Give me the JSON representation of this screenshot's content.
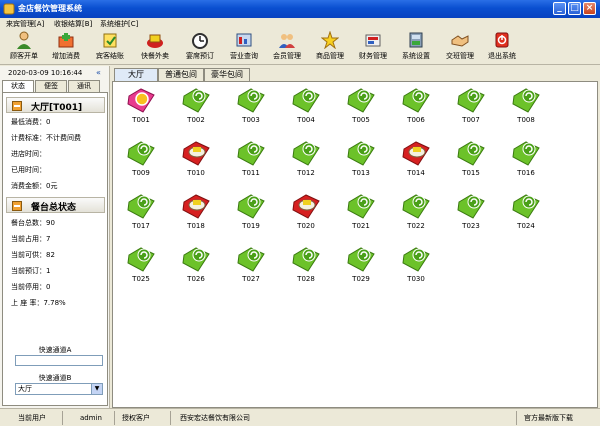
{
  "window": {
    "title": "金店餐饮管理系统"
  },
  "menu": [
    "来宾管理[A]",
    "收银结算[B]",
    "系统维护[C]"
  ],
  "toolbar": [
    {
      "label": "顾客开单",
      "icon": "person-icon"
    },
    {
      "label": "增加消费",
      "icon": "add-cart-icon"
    },
    {
      "label": "宾客结账",
      "icon": "checkout-icon"
    },
    {
      "label": "快餐外卖",
      "icon": "takeout-icon"
    },
    {
      "label": "宴席预订",
      "icon": "clock-icon"
    },
    {
      "label": "营业查询",
      "icon": "query-icon"
    },
    {
      "label": "会员管理",
      "icon": "members-icon"
    },
    {
      "label": "商品管理",
      "icon": "star-icon"
    },
    {
      "label": "财务管理",
      "icon": "finance-icon"
    },
    {
      "label": "系统设置",
      "icon": "settings-icon"
    },
    {
      "label": "交班管理",
      "icon": "handshake-icon"
    },
    {
      "label": "退出系统",
      "icon": "exit-icon"
    }
  ],
  "left": {
    "datetime": "2020-03-09 10:16:44",
    "collapse": "«",
    "tabs": [
      "状态",
      "便签",
      "通讯"
    ],
    "table_header": "大厅[T001]",
    "table_info": [
      "最低消费：0",
      "计费标准：不计费间费",
      "进店时间：",
      "已用时间：",
      "消费金额：0元"
    ],
    "status_header": "餐台总状态",
    "status_info": [
      "餐台总数：90",
      "当前占用：7",
      "当前可供：82",
      "当前预订：1",
      "当前停用：0",
      "上 座 率：7.78%"
    ],
    "quick_a_label": "快速通道A",
    "quick_a_value": "",
    "quick_b_label": "快速通道B",
    "quick_b_value": "大厅",
    "quick_b_arrow": "▼"
  },
  "tabs": [
    "大厅",
    "普通包间",
    "豪华包间"
  ],
  "tables": [
    {
      "name": "T001",
      "state": "selected"
    },
    {
      "name": "T002",
      "state": "free"
    },
    {
      "name": "T003",
      "state": "free"
    },
    {
      "name": "T004",
      "state": "free"
    },
    {
      "name": "T005",
      "state": "free"
    },
    {
      "name": "T006",
      "state": "free"
    },
    {
      "name": "T007",
      "state": "free"
    },
    {
      "name": "T008",
      "state": "free"
    },
    {
      "name": "T009",
      "state": "free"
    },
    {
      "name": "T010",
      "state": "occupied"
    },
    {
      "name": "T011",
      "state": "free"
    },
    {
      "name": "T012",
      "state": "free"
    },
    {
      "name": "T013",
      "state": "free"
    },
    {
      "name": "T014",
      "state": "occupied"
    },
    {
      "name": "T015",
      "state": "free"
    },
    {
      "name": "T016",
      "state": "free"
    },
    {
      "name": "T017",
      "state": "free"
    },
    {
      "name": "T018",
      "state": "occupied"
    },
    {
      "name": "T019",
      "state": "free"
    },
    {
      "name": "T020",
      "state": "occupied"
    },
    {
      "name": "T021",
      "state": "free"
    },
    {
      "name": "T022",
      "state": "free"
    },
    {
      "name": "T023",
      "state": "free"
    },
    {
      "name": "T024",
      "state": "free"
    },
    {
      "name": "T025",
      "state": "free"
    },
    {
      "name": "T026",
      "state": "free"
    },
    {
      "name": "T027",
      "state": "free"
    },
    {
      "name": "T028",
      "state": "free"
    },
    {
      "name": "T029",
      "state": "free"
    },
    {
      "name": "T030",
      "state": "free"
    }
  ],
  "status": {
    "user_label": "当前用户",
    "user": "admin",
    "client_label": "授权客户",
    "client": "西安宏达餐饮有限公司",
    "download": "官方最新版下载"
  },
  "colors": {
    "free": "#6cc229",
    "occupied": "#d62020",
    "selected": "#e83b8e",
    "accent": "#0a4fd0"
  }
}
